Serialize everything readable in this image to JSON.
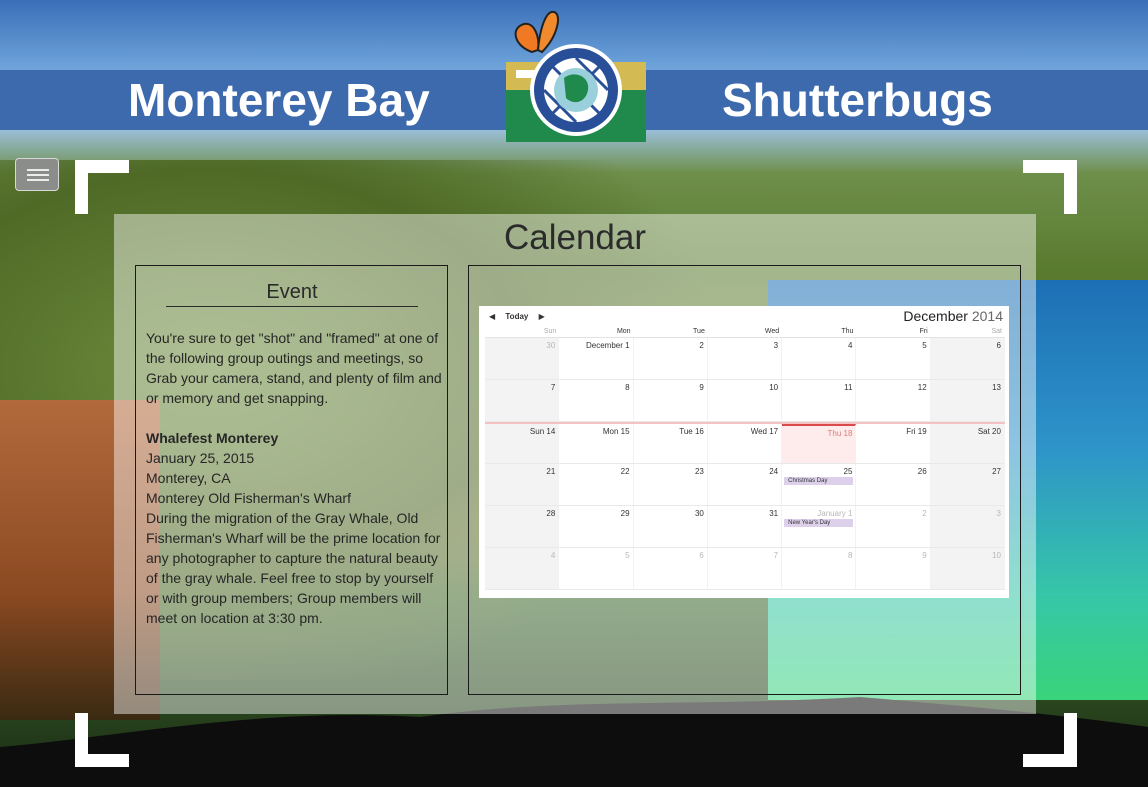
{
  "header": {
    "title_left": "Monterey Bay",
    "title_right": "Shutterbugs"
  },
  "menu": {
    "icon": "hamburger-icon"
  },
  "page": {
    "title": "Calendar"
  },
  "event": {
    "heading": "Event",
    "intro": "You're sure to get \"shot\" and \"framed\" at one of the following group outings and meetings, so Grab your camera, stand, and plenty of film and or memory and get snapping.",
    "name": "Whalefest Monterey",
    "date": "January 25, 2015",
    "city": "Monterey, CA",
    "venue": "Monterey Old Fisherman's Wharf",
    "description": "During the migration of the Gray Whale, Old Fisherman's Wharf will be the prime location for any photographer to capture the natural beauty of the gray whale. Feel free to stop by yourself or with group members; Group members will meet on location at 3:30 pm."
  },
  "calendar": {
    "prev": "◀",
    "today": "Today",
    "next": "▶",
    "month": "December",
    "year": "2014",
    "weekdays": [
      "Sun",
      "Mon",
      "Tue",
      "Wed",
      "Thu",
      "Fri",
      "Sat"
    ],
    "weeks": [
      [
        "30",
        "December 1",
        "2",
        "3",
        "4",
        "5",
        "6"
      ],
      [
        "7",
        "8",
        "9",
        "10",
        "11",
        "12",
        "13"
      ],
      [
        "Sun 14",
        "Mon 15",
        "Tue 16",
        "Wed 17",
        "Thu 18",
        "Fri 19",
        "Sat 20"
      ],
      [
        "21",
        "22",
        "23",
        "24",
        "25",
        "26",
        "27"
      ],
      [
        "28",
        "29",
        "30",
        "31",
        "January 1",
        "2",
        "3"
      ],
      [
        "4",
        "5",
        "6",
        "7",
        "8",
        "9",
        "10"
      ]
    ],
    "events": {
      "christmas": "Christmas Day",
      "new_year": "New Year's Day"
    }
  },
  "colors": {
    "banner": "#3d6aac",
    "accent_today": "#d94a4a",
    "event_chip": "#ddd0ea"
  }
}
